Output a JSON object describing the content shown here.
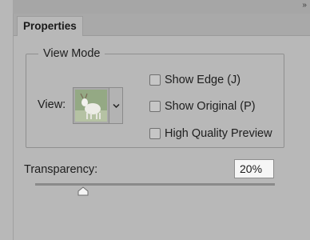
{
  "header": {
    "collapse_glyph": "››",
    "tab_label": "Properties"
  },
  "view_mode": {
    "legend": "View Mode",
    "view_label": "View:",
    "options": [
      {
        "label": "Show Edge (J)",
        "checked": false
      },
      {
        "label": "Show Original (P)",
        "checked": false
      },
      {
        "label": "High Quality Preview",
        "checked": false
      }
    ]
  },
  "transparency": {
    "label": "Transparency:",
    "value": "20%",
    "level": 0.2
  },
  "colors": {
    "panel_bg": "#b8b8b8",
    "tab_bar_bg": "#a9a9a9",
    "input_bg": "#f6f6f6"
  }
}
